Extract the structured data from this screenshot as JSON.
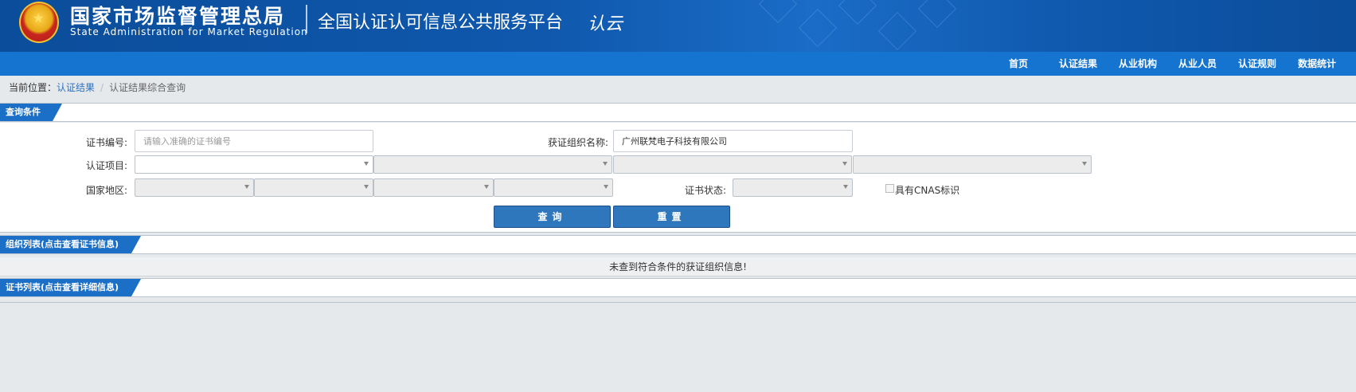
{
  "header": {
    "org_cn": "国家市场监督管理总局",
    "org_en": "State Administration  for  Market Regulation",
    "platform": "全国认证认可信息公共服务平台",
    "logo_text": "认云",
    "colors": {
      "header_bg": "#0f58ad",
      "nav_bg": "#1674d1",
      "tab_bg": "#1b6fc7",
      "button_bg": "#2f77bd"
    }
  },
  "nav": {
    "items": [
      "首页",
      "认证结果",
      "从业机构",
      "从业人员",
      "认证规则",
      "数据统计"
    ]
  },
  "breadcrumb": {
    "prefix": "当前位置：",
    "link": "认证结果",
    "separator": "/",
    "current": "认证结果综合查询"
  },
  "query": {
    "section_title": "查询条件",
    "cert_no_label": "证书编号:",
    "cert_no_placeholder": "请输入准确的证书编号",
    "cert_no_value": "",
    "org_name_label": "获证组织名称:",
    "org_name_value": "广州联梵电子科技有限公司",
    "project_label": "认证项目:",
    "region_label": "国家地区:",
    "status_label": "证书状态:",
    "cnas_label": "具有CNAS标识",
    "search_button": "查询",
    "reset_button": "重置"
  },
  "org_list": {
    "section_title": "组织列表(点击查看证书信息)",
    "empty_message": "未查到符合条件的获证组织信息!"
  },
  "cert_list": {
    "section_title": "证书列表(点击查看详细信息)"
  }
}
